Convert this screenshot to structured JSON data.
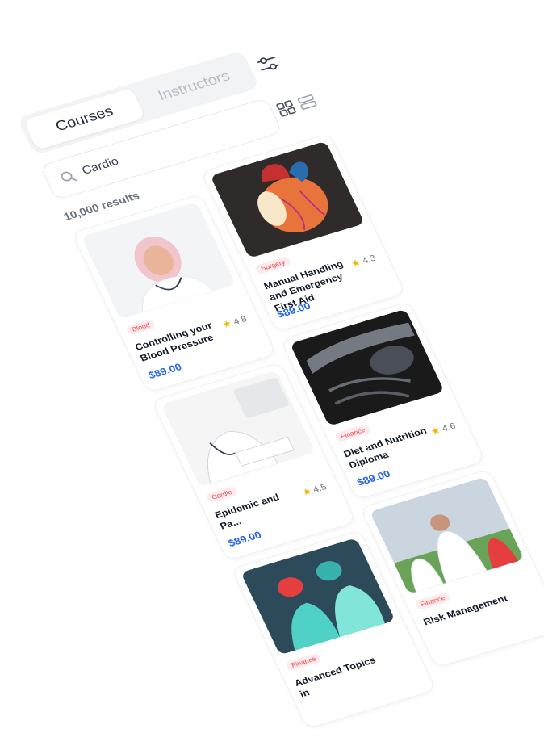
{
  "tabs": {
    "courses": "Courses",
    "instructors": "Instructors"
  },
  "search": {
    "query": "Cardio"
  },
  "results_label": "10,000 results",
  "courses": [
    {
      "badge": "Blood",
      "title": "Controlling your Blood Pressure",
      "rating": "4.8",
      "price": "$89.00"
    },
    {
      "badge": "Surgery",
      "title": "Manual Handling and Emergency First Aid",
      "rating": "4.3",
      "price": "$89.00"
    },
    {
      "badge": "Cardio",
      "title": "Epidemic and Pa...",
      "rating": "4.5",
      "price": "$89.00"
    },
    {
      "badge": "Finance",
      "title": "Diet and Nutrition Diploma",
      "rating": "4.6",
      "price": "$89.00"
    },
    {
      "badge": "Finance",
      "title": "Advanced Topics in",
      "rating": "",
      "price": ""
    },
    {
      "badge": "Finance",
      "title": "Risk Management",
      "rating": "",
      "price": ""
    }
  ],
  "colors": {
    "accent": "#2563eb",
    "badge": "#ef4444",
    "star": "#f5b400"
  },
  "icons": [
    "filter-icon",
    "grid-view-icon",
    "list-view-icon",
    "search-icon",
    "star-icon"
  ]
}
